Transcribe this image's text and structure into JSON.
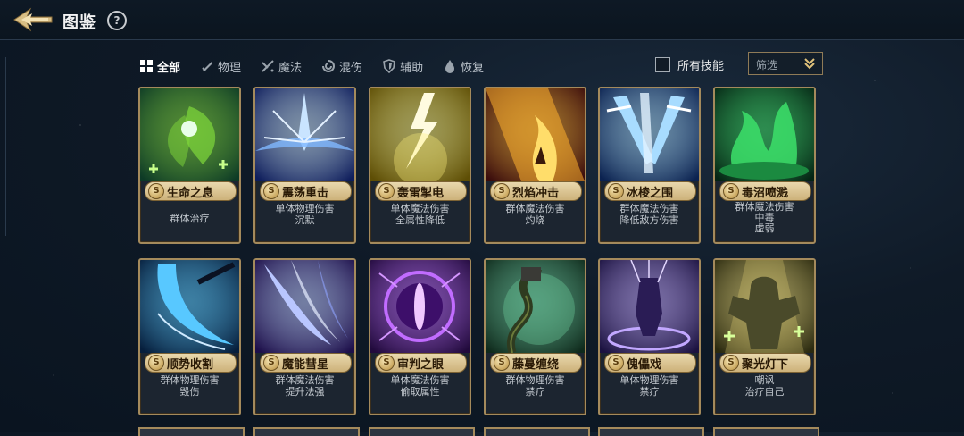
{
  "header": {
    "title": "图鉴",
    "help_icon": "?"
  },
  "filters": {
    "tabs": [
      {
        "label": "全部",
        "icon": "grid-icon",
        "active": true
      },
      {
        "label": "物理",
        "icon": "sword-icon",
        "active": false
      },
      {
        "label": "魔法",
        "icon": "magic-icon",
        "active": false
      },
      {
        "label": "混伤",
        "icon": "swirl-icon",
        "active": false
      },
      {
        "label": "辅助",
        "icon": "shield-icon",
        "active": false
      },
      {
        "label": "恢复",
        "icon": "drop-icon",
        "active": false
      }
    ],
    "all_skills_label": "所有技能",
    "all_skills_checked": false,
    "select_placeholder": "筛选"
  },
  "cards": [
    {
      "name": "生命之息",
      "badge": "S",
      "desc": [
        "群体治疗"
      ],
      "theme": "heal-leaf",
      "colors": [
        "#0d3a26",
        "#7fd83a"
      ]
    },
    {
      "name": "震荡重击",
      "badge": "S",
      "desc": [
        "单体物理伤害",
        "沉默"
      ],
      "theme": "shock-strike",
      "colors": [
        "#0f1e5c",
        "#c9e4ff"
      ]
    },
    {
      "name": "轰雷掣电",
      "badge": "S",
      "desc": [
        "单体魔法伤害",
        "全属性降低"
      ],
      "theme": "lightning",
      "colors": [
        "#5e4e05",
        "#fff27a"
      ]
    },
    {
      "name": "烈焰冲击",
      "badge": "S",
      "desc": [
        "群体魔法伤害",
        "灼烧"
      ],
      "theme": "flame",
      "colors": [
        "#3a0c0c",
        "#ffb02e"
      ]
    },
    {
      "name": "冰棱之围",
      "badge": "S",
      "desc": [
        "群体魔法伤害",
        "降低敌方伤害"
      ],
      "theme": "ice-swords",
      "colors": [
        "#0b2250",
        "#a8dcff"
      ]
    },
    {
      "name": "毒沼喷溅",
      "badge": "S",
      "desc": [
        "群体魔法伤害",
        "中毒",
        "虚弱"
      ],
      "theme": "poison",
      "colors": [
        "#052414",
        "#3ce06a"
      ]
    },
    {
      "name": "顺势收割",
      "badge": "S",
      "desc": [
        "群体物理伤害",
        "毁伤"
      ],
      "theme": "scythe",
      "colors": [
        "#061e3c",
        "#58c8ff"
      ]
    },
    {
      "name": "魔能彗星",
      "badge": "S",
      "desc": [
        "群体魔法伤害",
        "提升法强"
      ],
      "theme": "comet",
      "colors": [
        "#1d0f4a",
        "#b9c6ff"
      ]
    },
    {
      "name": "审判之眼",
      "badge": "S",
      "desc": [
        "单体魔法伤害",
        "偷取属性"
      ],
      "theme": "eye",
      "colors": [
        "#210a3c",
        "#c16cff"
      ]
    },
    {
      "name": "藤蔓缠绕",
      "badge": "S",
      "desc": [
        "群体物理伤害",
        "禁疗"
      ],
      "theme": "vine",
      "colors": [
        "#0f2a1c",
        "#6fd3a0"
      ]
    },
    {
      "name": "傀儡戏",
      "badge": "S",
      "desc": [
        "单体物理伤害",
        "禁疗"
      ],
      "theme": "puppet",
      "colors": [
        "#1b1240",
        "#c2a8ff"
      ]
    },
    {
      "name": "聚光灯下",
      "badge": "S",
      "desc": [
        "嘲讽",
        "治疗自己"
      ],
      "theme": "spotlight",
      "colors": [
        "#2b2a10",
        "#f3e07a"
      ]
    }
  ]
}
